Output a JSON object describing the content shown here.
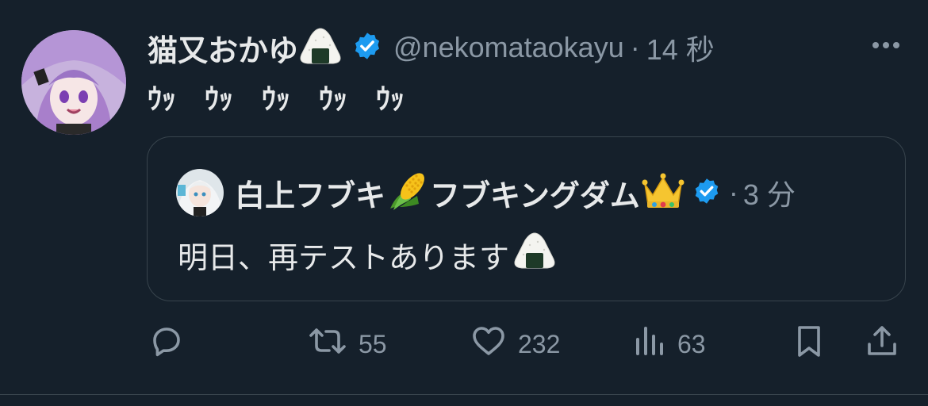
{
  "tweet": {
    "author_name": "猫又おかゆ",
    "handle": "@nekomataokayu",
    "separator": "·",
    "time": "14 秒",
    "text": "ｳｯ　ｳｯ　ｳｯ　ｳｯ　ｳｯ",
    "verified": true
  },
  "quote": {
    "author_name_part1": "白上フブキ",
    "author_name_part2": "フブキングダム",
    "separator": "·",
    "time": "3 分",
    "text": "明日、再テストあります",
    "verified": true
  },
  "actions": {
    "reply_count": "",
    "retweet_count": "55",
    "like_count": "232",
    "views_count": "63"
  },
  "colors": {
    "background": "#15202b",
    "text": "#e7e9ea",
    "muted": "#8b98a5",
    "verified": "#1d9bf0",
    "border": "#38444d"
  },
  "icons": [
    "avatar",
    "onigiri-emoji",
    "verified-badge-icon",
    "corn-emoji",
    "crown-emoji",
    "more-icon",
    "reply-icon",
    "retweet-icon",
    "like-icon",
    "views-icon",
    "bookmark-icon",
    "share-icon"
  ]
}
